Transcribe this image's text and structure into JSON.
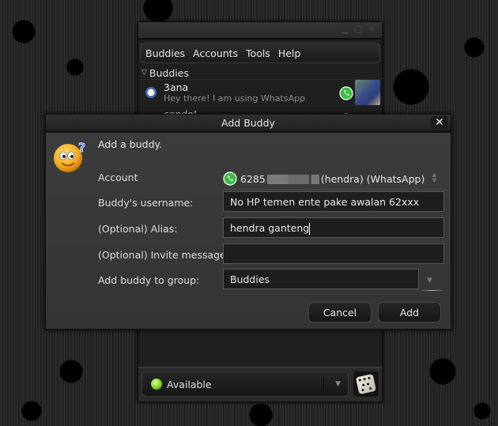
{
  "buddy_list": {
    "menu": [
      "Buddies",
      "Accounts",
      "Tools",
      "Help"
    ],
    "group_name": "Buddies",
    "buddies": [
      {
        "name": "3ana",
        "status_message": "Hey there! I am using WhatsApp",
        "protocol_icon": "whatsapp-icon",
        "status_icon": "away-clock-icon"
      },
      {
        "name": "cendoL",
        "status_message": "",
        "protocol_icon": "whatsapp-icon",
        "status_icon": "away-clock-icon"
      }
    ],
    "status": {
      "label": "Available",
      "color": "#7fd020"
    }
  },
  "dialog": {
    "title": "Add Buddy",
    "heading": "Add a buddy.",
    "account_label": "Account",
    "account_prefix": "6285",
    "account_suffix": "(hendra) (WhatsApp)",
    "username_label": "Buddy's username:",
    "username_value": "No HP temen ente pake awalan 62xxx",
    "alias_label": "(Optional) Alias:",
    "alias_value": "hendra ganteng",
    "invite_label": "(Optional) Invite message:",
    "invite_value": "",
    "group_label": "Add buddy to group:",
    "group_value": "Buddies",
    "cancel_label": "Cancel",
    "add_label": "Add"
  }
}
